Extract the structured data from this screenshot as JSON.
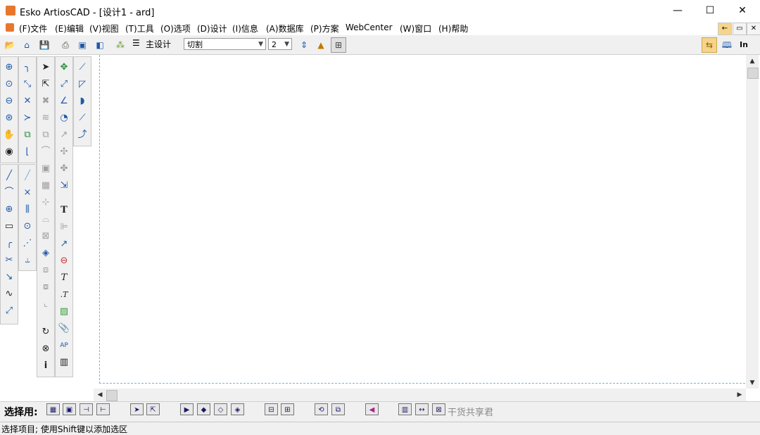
{
  "window": {
    "title": "Esko ArtiosCAD - [设计1 - ard]",
    "minimize_glyph": "—",
    "maximize_glyph": "☐",
    "close_glyph": "✕"
  },
  "menu": {
    "items": [
      "(F)文件",
      "(E)编辑",
      "(V)视图",
      "(T)工具",
      "(O)选项",
      "(D)设计",
      "(I)信息",
      "(A)数据库",
      "(P)方案",
      "WebCenter",
      "(W)窗口",
      "(H)帮助"
    ],
    "mdi_buttons": [
      "←",
      "▭",
      "✕"
    ]
  },
  "toolbar": {
    "main_design_label": "主设计",
    "layer_select": "切割",
    "pointsize_select": "2",
    "right_text": "In",
    "icons": [
      "open-icon",
      "open-database-icon",
      "save-icon",
      "print-icon",
      "output-icon",
      "3d-icon",
      "layer-icon",
      "grain-icon",
      "dimension-icon",
      "grid-icon",
      "back-icon",
      "book-icon"
    ]
  },
  "palettes": {
    "col1_top": [
      "zoom-in-icon",
      "zoom-window-icon",
      "zoom-out-icon",
      "zoom-extents-icon",
      "pan-hand-icon",
      "camera-icon"
    ],
    "col1_bottom": [
      "line-icon",
      "arc-icon",
      "circle-icon",
      "rectangle-icon",
      "fillet-icon",
      "trim-icon",
      "extend-icon",
      "bezier-icon",
      "point-icon"
    ],
    "col2_top": [
      "corner-icon",
      "adjust-icon",
      "trim-x-icon",
      "angle-icon",
      "scale-icon",
      "offset-icon"
    ],
    "col2_bottom": [
      "line-alt-icon",
      "cross-icon",
      "parallel-icon",
      "center-icon",
      "spread-icon",
      "bridge-icon"
    ],
    "col3": [
      "select-icon",
      "select-many-icon",
      "delete-icon",
      "layers-grey-icon",
      "group-grey-icon",
      "curve-grey-icon",
      "box-grey-icon",
      "box2-grey-icon",
      "nodes-grey-icon",
      "curve2-grey-icon",
      "box3-grey-icon",
      "cube-icon",
      "stack-grey-icon",
      "stack2-grey-icon",
      "stack3-grey-icon",
      "rotate-icon",
      "delete-node-icon",
      "info-icon"
    ],
    "col4": [
      "move-icon",
      "resize-icon",
      "angle-measure-icon",
      "radius-icon",
      "move-grey-icon",
      "move2-grey-icon",
      "move3-grey-icon",
      "transform-icon",
      "text-bold-icon",
      "align-grey-icon",
      "arrow-icon",
      "ellipse-text-icon",
      "text-italic-icon",
      "text-small-icon",
      "hatch-icon",
      "clip-icon",
      "ap-icon",
      "barcode-icon"
    ],
    "col5": [
      "dim-line-icon",
      "dim-angle-icon",
      "dim-arc-icon",
      "dim-diag-icon",
      "dim-step-icon"
    ]
  },
  "select_bar": {
    "label": "选择用:",
    "watermark": "干货共享君",
    "buttons": [
      "sel-item",
      "sel-window",
      "sel-line",
      "sel-arc",
      "sel-pointer",
      "sel-multi",
      "sel-next",
      "sel-prev",
      "sel-layer",
      "sel-all",
      "sel-frame",
      "sel-frame2",
      "sel-rotate",
      "sel-copy",
      "sel-pink",
      "sel-join",
      "sel-span",
      "sel-cross"
    ]
  },
  "status": {
    "text": "选择项目; 使用Shift键以添加选区"
  },
  "colors": {
    "accent": "#e8772e",
    "icon_blue": "#1e5aa8",
    "dashed_border": "#7bb3d6",
    "chrome": "#f0f0f0"
  }
}
